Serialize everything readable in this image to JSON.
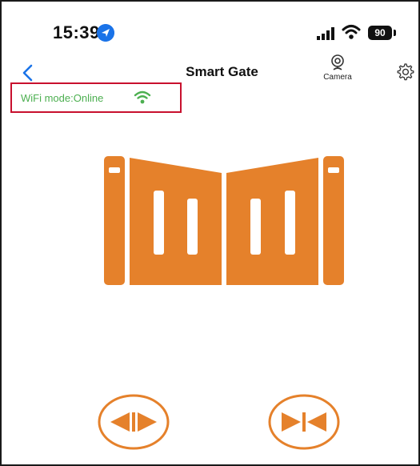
{
  "status_bar": {
    "time": "15:39",
    "battery": "90"
  },
  "header": {
    "title": "Smart Gate",
    "camera_label": "Camera"
  },
  "connection": {
    "status_text": "WiFi mode:Online"
  },
  "gate": {
    "icon": "double-swing-gate-icon",
    "color": "#e5812b"
  },
  "controls": [
    {
      "name": "open",
      "icon": "open-gate-arrows-icon"
    },
    {
      "name": "close",
      "icon": "close-gate-arrows-icon"
    }
  ],
  "colors": {
    "accent": "#e5812b",
    "online": "#4caf50",
    "highlight_box": "#c8102e",
    "back_arrow": "#1a73e8"
  }
}
